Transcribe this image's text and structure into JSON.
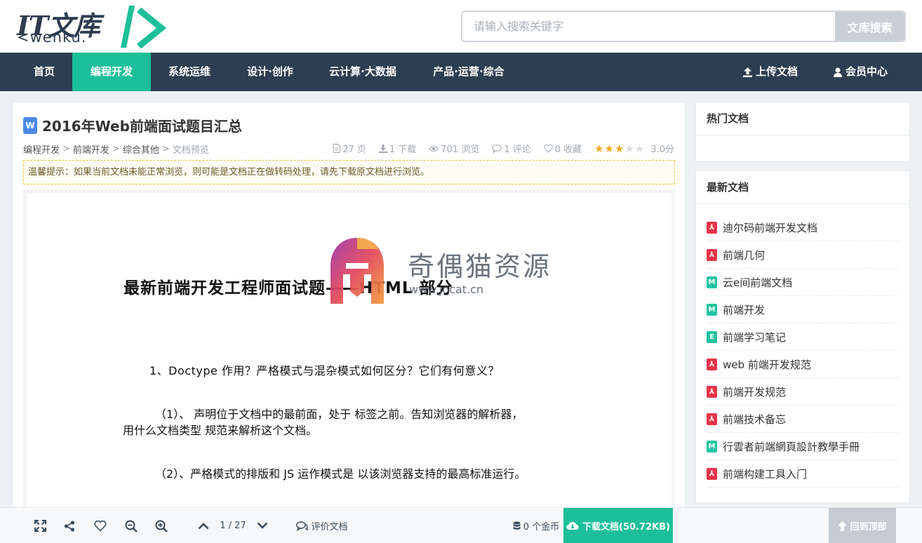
{
  "header": {
    "logo_main": "IT文库",
    "logo_sub": "<wenku.",
    "search_placeholder": "请输入搜索关键字",
    "search_button": "文库搜索"
  },
  "nav": {
    "items": [
      {
        "label": "首页",
        "active": false
      },
      {
        "label": "编程开发",
        "active": true
      },
      {
        "label": "系统运维",
        "active": false
      },
      {
        "label": "设计·创作",
        "active": false
      },
      {
        "label": "云计算·大数据",
        "active": false
      },
      {
        "label": "产品·运营·综合",
        "active": false
      }
    ],
    "upload": "上传文档",
    "member": "会员中心"
  },
  "document": {
    "type_icon": "W",
    "title": "2016年Web前端面试题目汇总",
    "breadcrumb": [
      "编程开发",
      "前端开发",
      "综合其他",
      "文档预览"
    ],
    "breadcrumb_sep": ">",
    "pages": "27 页",
    "downloads": "1 下载",
    "views": "701 浏览",
    "comments": "1 评论",
    "favorites": "0 收藏",
    "rating_stars": 3,
    "rating_max": 5,
    "score": "3.0分",
    "notice": "温馨提示：如果当前文档未能正常浏览，则可能是文档正在做转码处理，请先下载原文档进行浏览。"
  },
  "preview": {
    "heading": "最新前端开发工程师面试题——HTML 部分",
    "q1": "1、Doctype 作用？严格模式与混杂模式如何区分？它们有何意义？",
    "a1_line1": "（1）、 声明位于文档中的最前面，处于 标签之前。告知浏览器的解析器，",
    "a1_line2": "用什么文档类型 规范来解析这个文档。",
    "a2": "（2）、严格模式的排版和 JS 运作模式是  以该浏览器支持的最高标准运行。",
    "watermark_text": "奇偶猫资源",
    "watermark_url": "www.jocat.cn"
  },
  "sidebar": {
    "hot_title": "热门文档",
    "latest_title": "最新文档",
    "latest": [
      {
        "icon": "pdf",
        "glyph": "⅄",
        "label": "迪尔码前端开发文档"
      },
      {
        "icon": "pdf",
        "glyph": "⅄",
        "label": "前端几何"
      },
      {
        "icon": "md",
        "glyph": "M",
        "label": "云e间前端文档"
      },
      {
        "icon": "md",
        "glyph": "M",
        "label": "前端开发"
      },
      {
        "icon": "md",
        "glyph": "E",
        "label": "前端学习笔记"
      },
      {
        "icon": "pdf",
        "glyph": "⅄",
        "label": "web 前端开发规范"
      },
      {
        "icon": "pdf",
        "glyph": "⅄",
        "label": "前端开发规范"
      },
      {
        "icon": "pdf",
        "glyph": "⅄",
        "label": "前端技术备忘"
      },
      {
        "icon": "md",
        "glyph": "M",
        "label": "行雲者前端網頁設計教學手冊"
      },
      {
        "icon": "pdf",
        "glyph": "⅄",
        "label": "前端构建工具入门"
      }
    ]
  },
  "toolbar": {
    "page_indicator": "1 / 27",
    "comment": "评价文档",
    "coins": "0 个金币",
    "download": "下载文档(50.72KB)",
    "back_top": "回到顶部"
  },
  "colors": {
    "brand": "#1dbf9a",
    "nav_bg": "#2e3e52",
    "star": "#f5a623",
    "pdf": "#e8344a",
    "word": "#4c89e8"
  }
}
